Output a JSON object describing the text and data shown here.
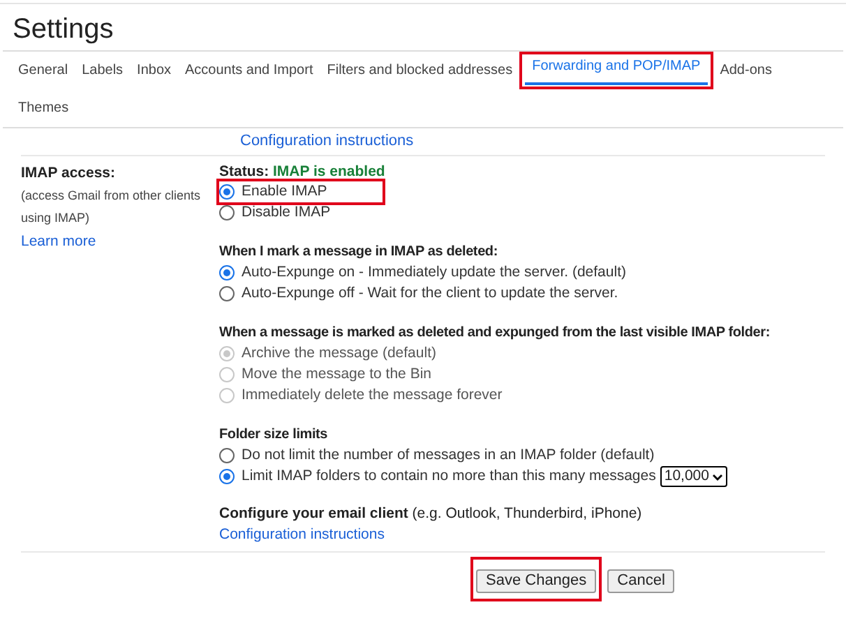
{
  "title": "Settings",
  "tabs": [
    {
      "label": "General",
      "selected": false,
      "highlighted": false
    },
    {
      "label": "Labels",
      "selected": false,
      "highlighted": false
    },
    {
      "label": "Inbox",
      "selected": false,
      "highlighted": false
    },
    {
      "label": "Accounts and Import",
      "selected": false,
      "highlighted": false
    },
    {
      "label": "Filters and blocked addresses",
      "selected": false,
      "highlighted": false
    },
    {
      "label": "Forwarding and POP/IMAP",
      "selected": true,
      "highlighted": true
    },
    {
      "label": "Add-ons",
      "selected": false,
      "highlighted": false
    },
    {
      "label": "Themes",
      "selected": false,
      "highlighted": false
    }
  ],
  "top_link": "Configuration instructions",
  "imap": {
    "label": "IMAP access:",
    "description": "(access Gmail from other clients using IMAP)",
    "learn_more": "Learn more",
    "status_label": "Status:",
    "status_value": "IMAP is enabled",
    "groups": [
      {
        "options": [
          {
            "label": "Enable IMAP",
            "selected": true,
            "disabled": false,
            "highlighted": true
          },
          {
            "label": "Disable IMAP",
            "selected": false,
            "disabled": false,
            "highlighted": false
          }
        ]
      },
      {
        "heading": "When I mark a message in IMAP as deleted:",
        "options": [
          {
            "label": "Auto-Expunge on - Immediately update the server. (default)",
            "selected": true,
            "disabled": false,
            "highlighted": false
          },
          {
            "label": "Auto-Expunge off - Wait for the client to update the server.",
            "selected": false,
            "disabled": false,
            "highlighted": false
          }
        ]
      },
      {
        "heading": "When a message is marked as deleted and expunged from the last visible IMAP folder:",
        "options": [
          {
            "label": "Archive the message (default)",
            "selected": true,
            "disabled": true,
            "highlighted": false
          },
          {
            "label": "Move the message to the Bin",
            "selected": false,
            "disabled": true,
            "highlighted": false
          },
          {
            "label": "Immediately delete the message forever",
            "selected": false,
            "disabled": true,
            "highlighted": false
          }
        ]
      },
      {
        "heading": "Folder size limits",
        "options": [
          {
            "label": "Do not limit the number of messages in an IMAP folder (default)",
            "selected": false,
            "disabled": false,
            "highlighted": false
          },
          {
            "label": "Limit IMAP folders to contain no more than this many messages",
            "selected": true,
            "disabled": false,
            "highlighted": false,
            "select": "10,000"
          }
        ]
      }
    ],
    "configure": "**Configure your email client** (e.g. Outlook, Thunderbird, iPhone)",
    "config_link": "Configuration instructions"
  },
  "buttons": [
    {
      "label": "Save Changes",
      "highlighted": true
    },
    {
      "label": "Cancel",
      "highlighted": false
    }
  ]
}
